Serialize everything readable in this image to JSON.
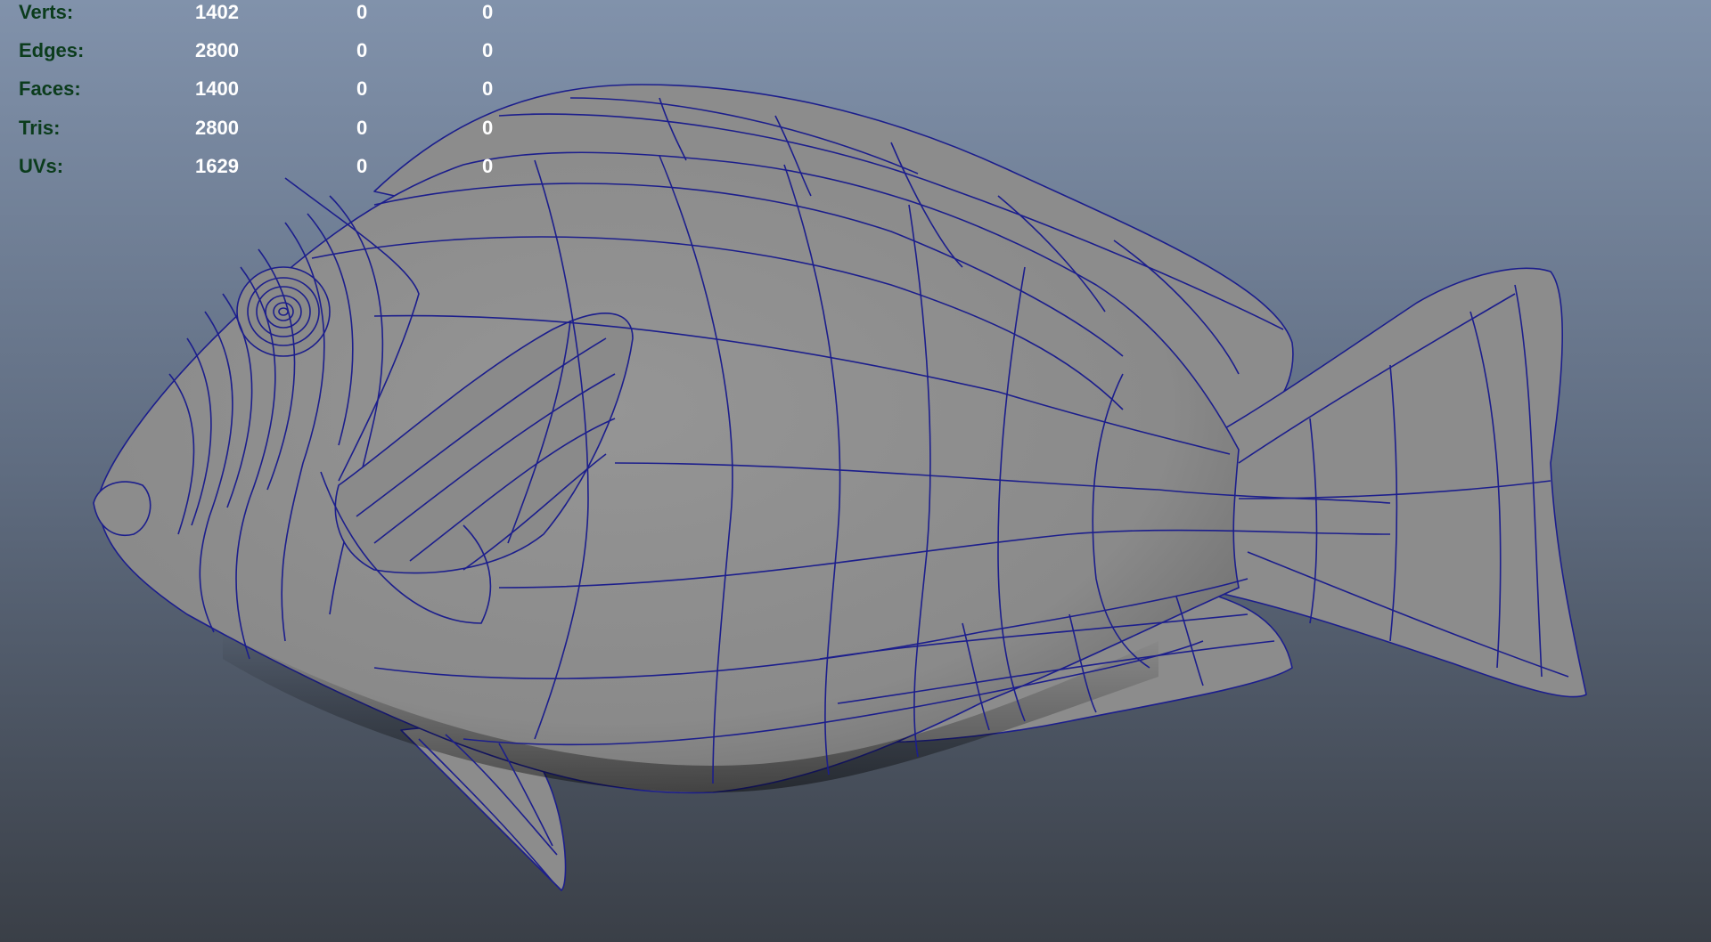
{
  "viewport": {
    "background_top": "#8192ab",
    "background_bottom": "#3a3f47",
    "wire_color": "#1c1e8c",
    "mesh_color": "#8c8c8c",
    "model": "fish-mesh"
  },
  "heads_up_display": {
    "rows": [
      {
        "label": "Verts:",
        "total": "1402",
        "selected": "0",
        "component": "0"
      },
      {
        "label": "Edges:",
        "total": "2800",
        "selected": "0",
        "component": "0"
      },
      {
        "label": "Faces:",
        "total": "1400",
        "selected": "0",
        "component": "0"
      },
      {
        "label": "Tris:",
        "total": "2800",
        "selected": "0",
        "component": "0"
      },
      {
        "label": "UVs:",
        "total": "1629",
        "selected": "0",
        "component": "0"
      }
    ]
  }
}
